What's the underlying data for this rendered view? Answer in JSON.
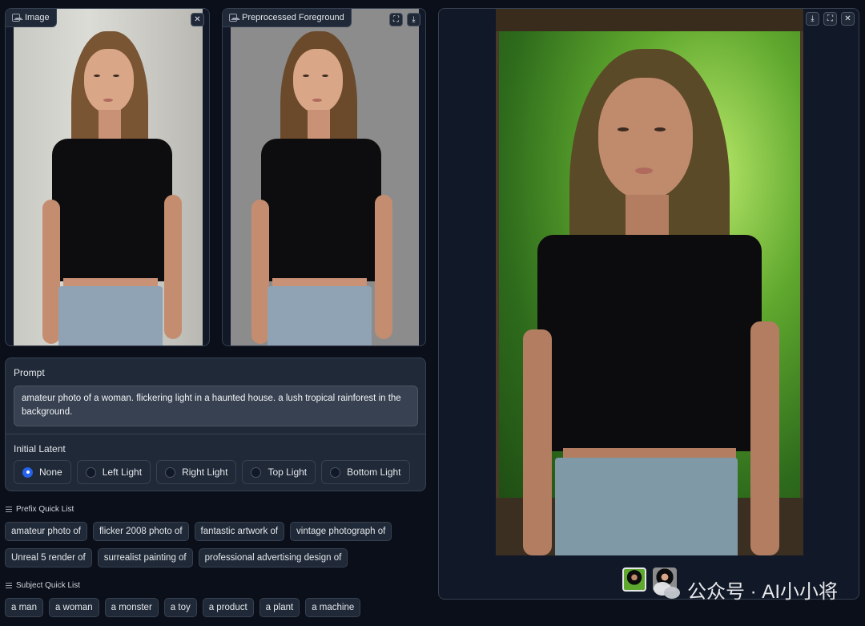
{
  "image_panel": {
    "label": "Image",
    "close_icon": "close-icon"
  },
  "foreground_panel": {
    "label": "Preprocessed Foreground"
  },
  "prompt": {
    "label": "Prompt",
    "value": "amateur photo of a woman. flickering light in a haunted house. a lush tropical rainforest in the background."
  },
  "initial_latent": {
    "label": "Initial Latent",
    "options": [
      "None",
      "Left Light",
      "Right Light",
      "Top Light",
      "Bottom Light"
    ],
    "selected": "None"
  },
  "prefix_list": {
    "title": "Prefix Quick List",
    "items": [
      "amateur photo of",
      "flicker 2008 photo of",
      "fantastic artwork of",
      "vintage photograph of",
      "Unreal 5 render of",
      "surrealist painting of",
      "professional advertising design of"
    ]
  },
  "subject_list": {
    "title": "Subject Quick List",
    "items": [
      "a man",
      "a woman",
      "a monster",
      "a toy",
      "a product",
      "a plant",
      "a machine"
    ]
  },
  "watermark": {
    "text": "公众号 · AI小小将"
  },
  "colors": {
    "accent": "#2563eb",
    "background": "#0b0f19",
    "panel": "#1f2937",
    "border": "#374151"
  }
}
